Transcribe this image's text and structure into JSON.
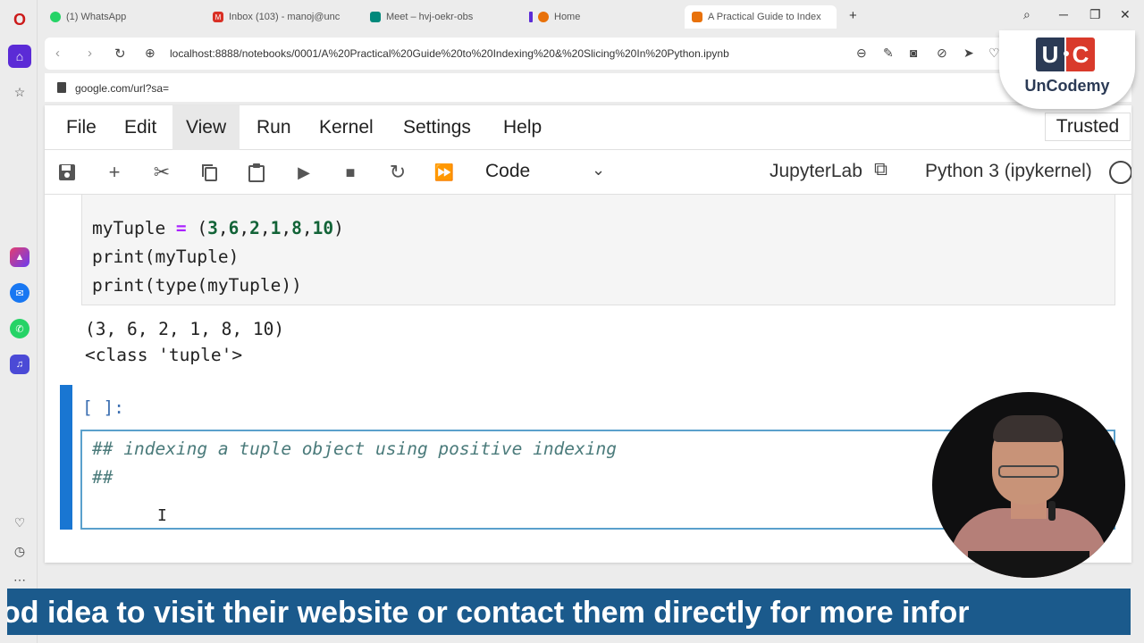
{
  "browser": {
    "tabs": [
      {
        "label": "(1) WhatsApp",
        "favicon_color": "#25d366"
      },
      {
        "label": "Inbox (103) - manoj@unc",
        "favicon_color": "#d93025"
      },
      {
        "label": "Meet – hvj-oekr-obs",
        "favicon_color": "#00897b"
      },
      {
        "label": "Home",
        "favicon_color": "#e8710a"
      },
      {
        "label": "A Practical Guide to Index",
        "favicon_color": "#e8710a"
      }
    ],
    "new_tab_symbol": "+",
    "url": "localhost:8888/notebooks/0001/A%20Practical%20Guide%20to%20Indexing%20&%20Slicing%20In%20Python.ipynb",
    "hint_url": "google.com/url?sa="
  },
  "jupyter": {
    "menu": [
      "File",
      "Edit",
      "View",
      "Run",
      "Kernel",
      "Settings",
      "Help"
    ],
    "active_menu": "View",
    "trusted_label": "Trusted",
    "cell_type": "Code",
    "jupyterlab_label": "JupyterLab",
    "kernel_label": "Python 3 (ipykernel)",
    "code_cell": {
      "line1_var": "myTuple",
      "line1_eq": " = ",
      "line1_open": "(",
      "line1_nums": [
        "3",
        "6",
        "2",
        "1",
        "8",
        "10"
      ],
      "line1_close": ")",
      "line2": "print(myTuple)",
      "line3": "print(type(myTuple))"
    },
    "output": [
      "(3, 6, 2, 1, 8, 10)",
      "<class 'tuple'>"
    ],
    "active_cell": {
      "prompt": "[ ]:",
      "lines": [
        "## indexing a tuple object using positive indexing",
        "##"
      ]
    }
  },
  "logo": {
    "letter1": "U",
    "letter2": "C",
    "brand": "UnCodemy",
    "dark": "#2b3a55",
    "red": "#d93a2b"
  },
  "subtitle": "od idea to visit their website or contact them directly for more infor"
}
